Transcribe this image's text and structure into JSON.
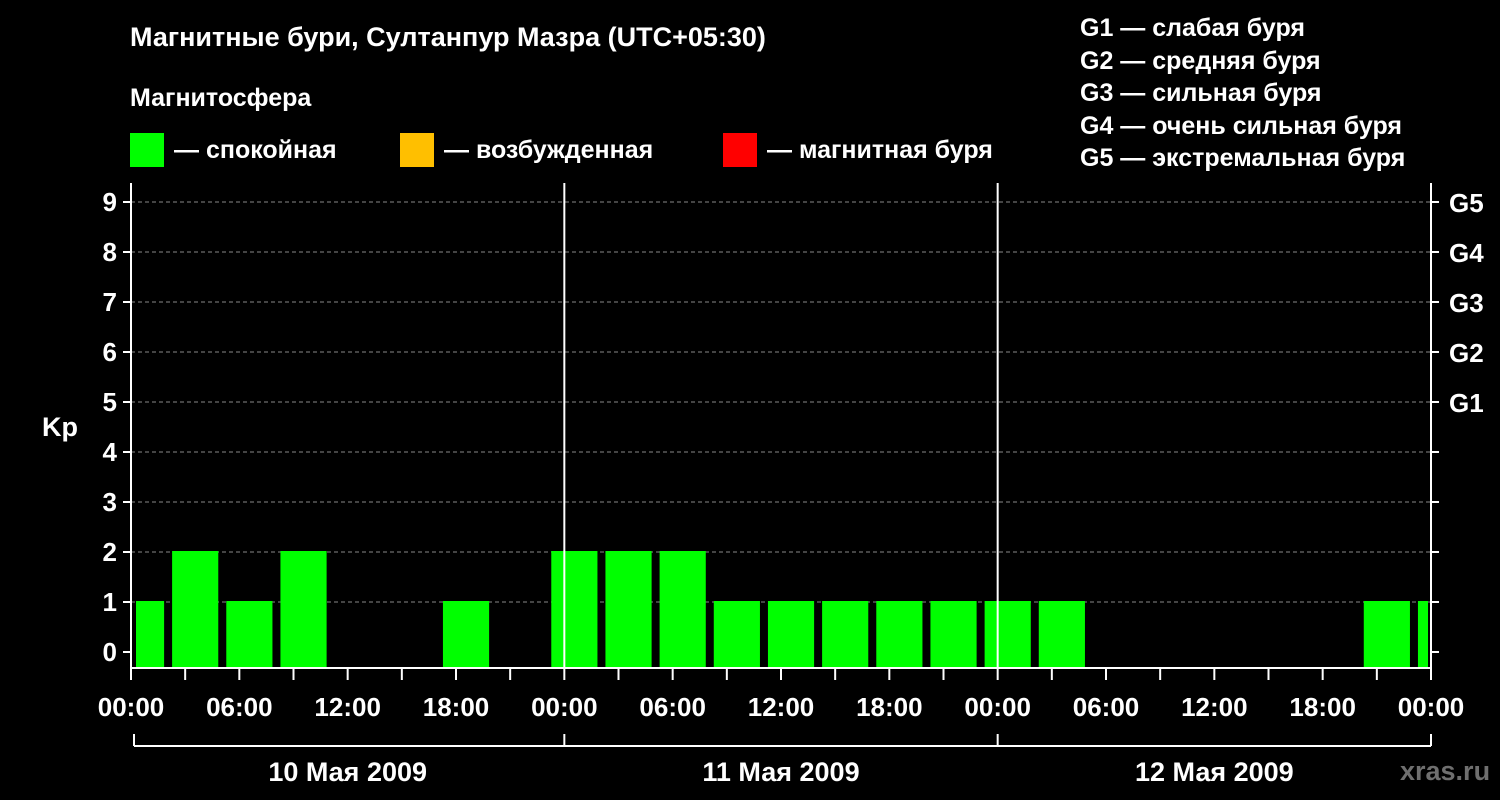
{
  "chart_data": {
    "type": "bar",
    "title": "Магнитные бури, Султанпур Мазра (UTC+05:30)",
    "subtitle": "Магнитосфера",
    "ylabel": "Kp",
    "ylim": [
      0,
      9
    ],
    "yticks": [
      "0",
      "1",
      "2",
      "3",
      "4",
      "5",
      "6",
      "7",
      "8",
      "9"
    ],
    "xlim_hours": [
      0,
      72
    ],
    "xtick_labels": [
      "00:00",
      "06:00",
      "12:00",
      "18:00",
      "00:00",
      "06:00",
      "12:00",
      "18:00",
      "00:00",
      "06:00",
      "12:00",
      "18:00",
      "00:00"
    ],
    "days": [
      "10 Мая 2009",
      "11 Мая 2009",
      "12 Мая 2009"
    ],
    "right_axis": [
      {
        "label": "G1",
        "kp": 5
      },
      {
        "label": "G2",
        "kp": 6
      },
      {
        "label": "G3",
        "kp": 7
      },
      {
        "label": "G4",
        "kp": 8
      },
      {
        "label": "G5",
        "kp": 9
      }
    ],
    "grid": true,
    "colors": {
      "quiet": "#00ff00",
      "active": "#ffbf00",
      "storm": "#ff0000",
      "grid": "#888888",
      "axis": "#ffffff"
    },
    "legend": [
      {
        "label": "— спокойная",
        "color": "#00ff00"
      },
      {
        "label": "— возбужденная",
        "color": "#ffbf00"
      },
      {
        "label": "— магнитная буря",
        "color": "#ff0000"
      }
    ],
    "g_legend": [
      "G1 — слабая буря",
      "G2 — средняя буря",
      "G3 — сильная буря",
      "G4 — очень сильная буря",
      "G5 — экстремальная буря"
    ],
    "bars": [
      {
        "start": 0,
        "end": 2,
        "kp": 1
      },
      {
        "start": 2,
        "end": 5,
        "kp": 2
      },
      {
        "start": 5,
        "end": 8,
        "kp": 1
      },
      {
        "start": 8,
        "end": 11,
        "kp": 2
      },
      {
        "start": 11,
        "end": 14,
        "kp": 0
      },
      {
        "start": 14,
        "end": 17,
        "kp": 0
      },
      {
        "start": 17,
        "end": 20,
        "kp": 1
      },
      {
        "start": 20,
        "end": 23,
        "kp": 0
      },
      {
        "start": 23,
        "end": 26,
        "kp": 2
      },
      {
        "start": 26,
        "end": 29,
        "kp": 2
      },
      {
        "start": 29,
        "end": 32,
        "kp": 2
      },
      {
        "start": 32,
        "end": 35,
        "kp": 1
      },
      {
        "start": 35,
        "end": 38,
        "kp": 1
      },
      {
        "start": 38,
        "end": 41,
        "kp": 1
      },
      {
        "start": 41,
        "end": 44,
        "kp": 1
      },
      {
        "start": 44,
        "end": 47,
        "kp": 1
      },
      {
        "start": 47,
        "end": 50,
        "kp": 1
      },
      {
        "start": 50,
        "end": 53,
        "kp": 1
      },
      {
        "start": 53,
        "end": 56,
        "kp": 0
      },
      {
        "start": 56,
        "end": 59,
        "kp": 0
      },
      {
        "start": 59,
        "end": 62,
        "kp": 0
      },
      {
        "start": 62,
        "end": 65,
        "kp": 0
      },
      {
        "start": 65,
        "end": 68,
        "kp": 0
      },
      {
        "start": 68,
        "end": 71,
        "kp": 1
      },
      {
        "start": 71,
        "end": 72,
        "kp": 1
      }
    ]
  },
  "watermark": "xras.ru"
}
